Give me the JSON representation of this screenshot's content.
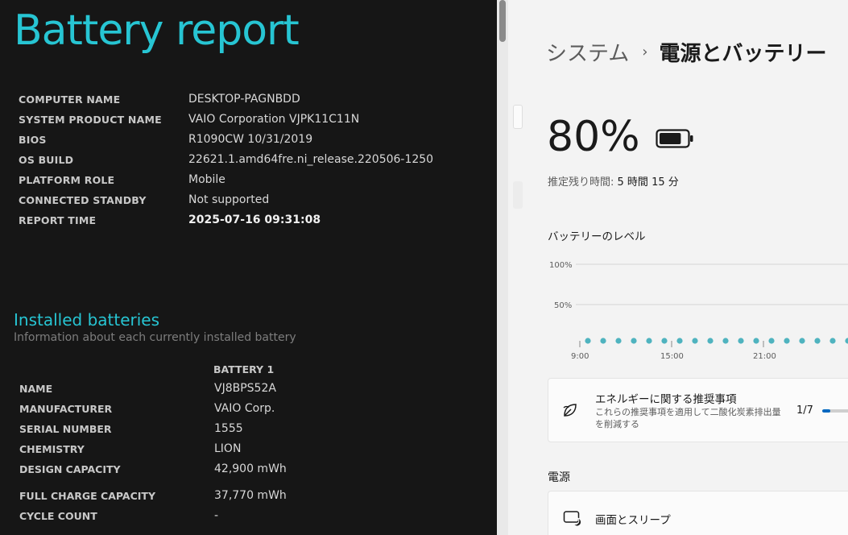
{
  "report": {
    "title": "Battery report",
    "system_info": [
      {
        "key": "COMPUTER NAME",
        "value": "DESKTOP-PAGNBDD"
      },
      {
        "key": "SYSTEM PRODUCT NAME",
        "value": "VAIO Corporation VJPK11C11N"
      },
      {
        "key": "BIOS",
        "value": "R1090CW 10/31/2019"
      },
      {
        "key": "OS BUILD",
        "value": "22621.1.amd64fre.ni_release.220506-1250"
      },
      {
        "key": "PLATFORM ROLE",
        "value": "Mobile"
      },
      {
        "key": "CONNECTED STANDBY",
        "value": "Not supported"
      },
      {
        "key": "REPORT TIME",
        "value": "2025-07-16  09:31:08"
      }
    ],
    "installed_title": "Installed batteries",
    "installed_subtitle": "Information about each currently installed battery",
    "battery_column": "BATTERY 1",
    "battery_rows": [
      {
        "key": "NAME",
        "value": "VJ8BPS52A"
      },
      {
        "key": "MANUFACTURER",
        "value": "VAIO Corp."
      },
      {
        "key": "SERIAL NUMBER",
        "value": "1555"
      },
      {
        "key": "CHEMISTRY",
        "value": "LION"
      },
      {
        "key": "DESIGN CAPACITY",
        "value": "42,900 mWh"
      },
      {
        "key": "FULL CHARGE CAPACITY",
        "value": "37,770 mWh"
      },
      {
        "key": "CYCLE COUNT",
        "value": "-"
      }
    ],
    "accent_color": "#27c5d3"
  },
  "settings": {
    "breadcrumb": {
      "parent": "システム",
      "separator": "›",
      "current": "電源とバッテリー"
    },
    "battery_percent": "80%",
    "battery_level_fraction": 0.8,
    "battery_icon": "battery-icon",
    "remaining_label": "推定残り時間:",
    "remaining_value": "5 時間 15 分",
    "level_title": "バッテリーのレベル",
    "chart_data": {
      "type": "scatter",
      "title": "",
      "xlabel": "",
      "ylabel": "",
      "y_ticks": [
        "100%",
        "50%"
      ],
      "x_ticks": [
        "9:00",
        "15:00",
        "21:00"
      ],
      "ylim": [
        0,
        100
      ],
      "grid": true,
      "point_color": "#4fb3bf",
      "point_count": 21
    },
    "energy_card": {
      "icon": "leaf-icon",
      "title": "エネルギーに関する推奨事項",
      "description": "これらの推奨事項を適用して二酸化炭素排出量を削減する",
      "count": "1/7",
      "progress_fraction": 0.143
    },
    "power_section_title": "電源",
    "sleep_card": {
      "icon": "screen-sleep-icon",
      "label": "画面とスリープ"
    }
  }
}
